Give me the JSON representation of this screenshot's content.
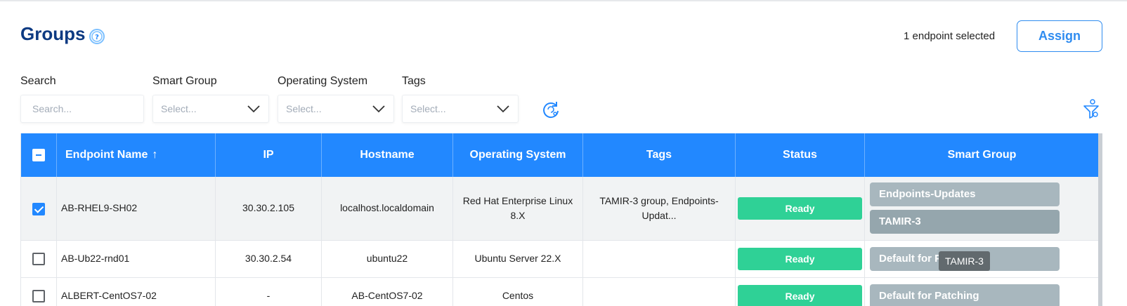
{
  "page": {
    "title": "Groups",
    "selection_text": "1 endpoint selected",
    "assign_label": "Assign"
  },
  "filters": {
    "search_label": "Search",
    "search_placeholder": "Search...",
    "smart_group_label": "Smart Group",
    "smart_group_placeholder": "Select...",
    "os_label": "Operating System",
    "os_placeholder": "Select...",
    "tags_label": "Tags",
    "tags_placeholder": "Select..."
  },
  "table": {
    "columns": [
      "Endpoint Name",
      "IP",
      "Hostname",
      "Operating System",
      "Tags",
      "Status",
      "Smart Group"
    ],
    "sort_indicator": "↑",
    "rows": [
      {
        "selected": true,
        "endpoint_name": "AB-RHEL9-SH02",
        "ip": "30.30.2.105",
        "hostname": "localhost.localdomain",
        "os": "Red Hat Enterprise Linux 8.X",
        "tags": "TAMIR-3 group, Endpoints-Updat...",
        "status": "Ready",
        "smart_groups": [
          "Endpoints-Updates",
          "TAMIR-3"
        ]
      },
      {
        "selected": false,
        "endpoint_name": "AB-Ub22-rnd01",
        "ip": "30.30.2.54",
        "hostname": "ubuntu22",
        "os": "Ubuntu Server 22.X",
        "tags": "",
        "status": "Ready",
        "smart_groups": [
          "Default for Patching"
        ],
        "tooltip": "TAMIR-3"
      },
      {
        "selected": false,
        "endpoint_name": "ALBERT-CentOS7-02",
        "ip": "-",
        "hostname": "AB-CentOS7-02",
        "os": "Centos",
        "tags": "",
        "status": "Ready",
        "smart_groups": [
          "Default for Patching"
        ]
      }
    ]
  },
  "colors": {
    "header_blue": "#2288ff",
    "title_navy": "#0d3a82",
    "status_green": "#2fd196",
    "chip_gray": "#a8b7be"
  },
  "icons": [
    "help-icon",
    "chevron-down-icon",
    "reset-icon",
    "filter-settings-icon"
  ]
}
